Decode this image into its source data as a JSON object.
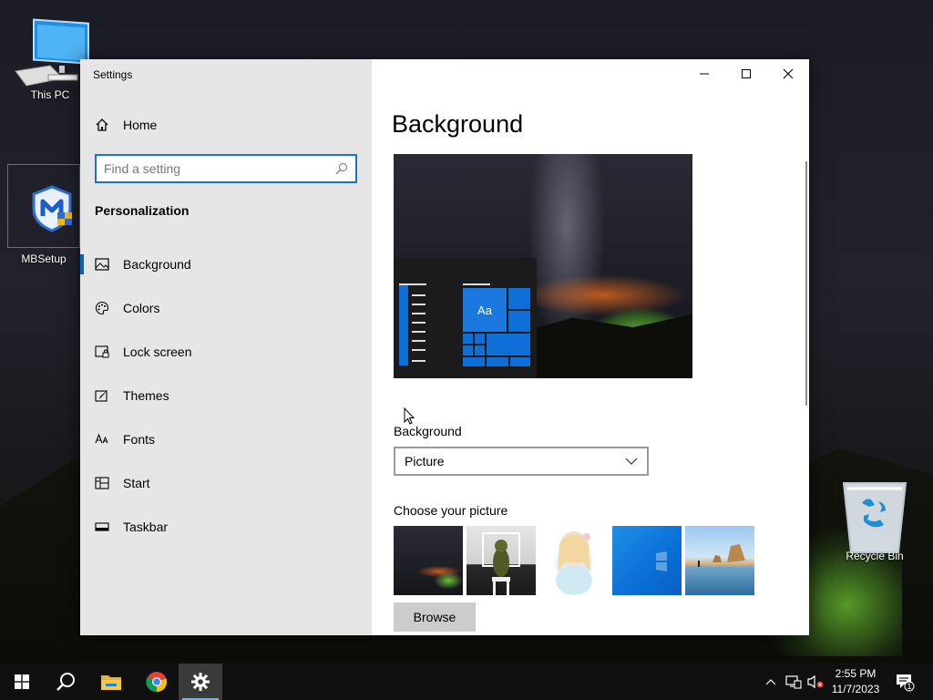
{
  "desktop": {
    "icons": [
      {
        "label": "This PC"
      },
      {
        "label": "MBSetup"
      },
      {
        "label": "Recycle Bin"
      }
    ]
  },
  "window": {
    "title": "Settings",
    "caption": {
      "minimize": "minimize-icon",
      "maximize": "maximize-icon",
      "close": "close-icon"
    }
  },
  "sidebar": {
    "home_label": "Home",
    "search_placeholder": "Find a setting",
    "section_title": "Personalization",
    "items": [
      {
        "label": "Background",
        "icon": "picture-icon",
        "active": true
      },
      {
        "label": "Colors",
        "icon": "palette-icon"
      },
      {
        "label": "Lock screen",
        "icon": "lock-screen-icon"
      },
      {
        "label": "Themes",
        "icon": "brush-icon"
      },
      {
        "label": "Fonts",
        "icon": "font-icon"
      },
      {
        "label": "Start",
        "icon": "start-icon"
      },
      {
        "label": "Taskbar",
        "icon": "taskbar-icon"
      }
    ]
  },
  "content": {
    "page_title": "Background",
    "preview_tile_text": "Aa",
    "background_label": "Background",
    "background_value": "Picture",
    "choose_label": "Choose your picture",
    "browse_label": "Browse"
  },
  "taskbar": {
    "time": "2:55 PM",
    "date": "11/7/2023",
    "notification_count": "1"
  },
  "colors": {
    "accent": "#0067c0",
    "sidebar_bg": "#e6e6e6",
    "taskbar_bg": "#101010"
  }
}
